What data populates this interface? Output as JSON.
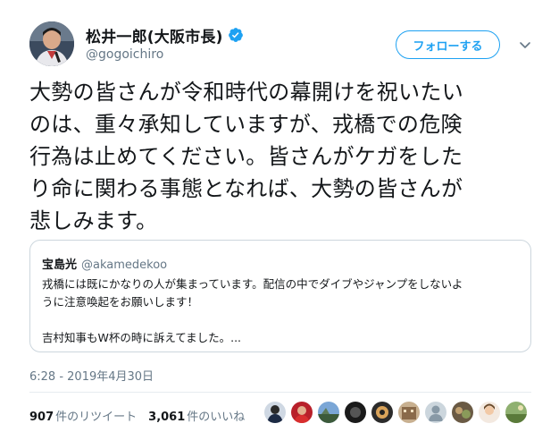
{
  "author": {
    "display_name": "松井一郎(大阪市長)",
    "handle": "@gogoichiro",
    "avatar_icon": "person-avatar-icon",
    "verified_icon": "verified-badge-icon"
  },
  "follow_label": "フォローする",
  "tweet_text": "大勢の皆さんが令和時代の幕開けを祝いたい\nのは、重々承知していますが、戎橋での危険\n行為は止めてください。皆さんがケガをした\nり命に関わる事態となれば、大勢の皆さんが\n悲しみます。",
  "quote": {
    "display_name": "宝島光",
    "handle": "@akamedekoo",
    "text": "戎橋には既にかなりの人が集まっています。配信の中でダイブやジャンプをしないよ\nうに注意喚起をお願いします！\n\n吉村知事もW杯の時に訴えてました。..."
  },
  "timestamp": "6:28 - 2019年4月30日",
  "stats": {
    "retweets_count": "907",
    "retweets_label": "件のリツイート",
    "likes_count": "3,061",
    "likes_label": "件のいいね"
  },
  "colors": {
    "accent": "#1da1f2",
    "secondary_text": "#657786",
    "border": "#ccd6dd"
  }
}
